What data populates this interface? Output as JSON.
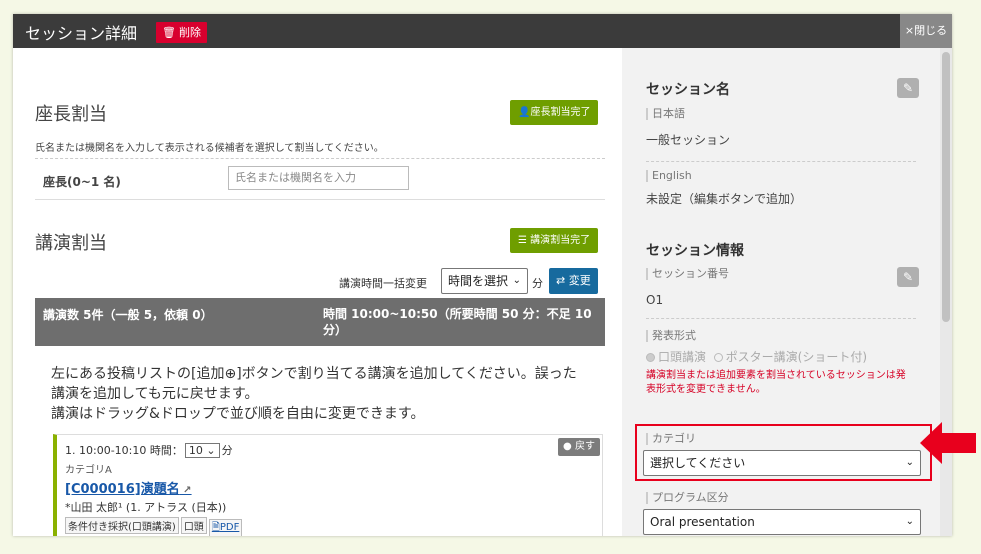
{
  "header": {
    "title": "セッション詳細",
    "delete_label": "削除",
    "close_label": "×閉じる"
  },
  "chair": {
    "title": "座長割当",
    "complete_button": "座長割当完了",
    "note": "氏名または機関名を入力して表示される候補者を選択して割当してください。",
    "field_label": "座長(0~1 名)",
    "input_placeholder": "氏名または機関名を入力"
  },
  "talks": {
    "title": "講演割当",
    "complete_button": "講演割当完了",
    "bulk_time_label": "講演時間一括変更",
    "time_select_value": "時間を選択",
    "minute_unit": "分",
    "change_button": "変更",
    "summary_left": "講演数 5件（一般 5，依頼 0）",
    "summary_right": "時間 10:00~10:50（所要時間 50 分：不足 10 分）",
    "instructions": [
      "左にある投稿リストの[追加⊕]ボタンで割り当てる講演を追加してください。誤った",
      "講演を追加しても元に戻せます。",
      "講演はドラッグ&ドロップで並び順を自由に変更できます。"
    ],
    "item": {
      "time_prefix": "1. 10:00-10:10  時間：",
      "duration": "10",
      "duration_unit": "分",
      "back_label": "戻す",
      "category": "カテゴリA",
      "title": "[C000016]演題名",
      "author": "*山田 太郎¹ (1. アトラス (日本))",
      "tags": [
        "条件付き採択(口頭講演)",
        "口頭",
        "PDF"
      ]
    }
  },
  "right": {
    "session_name_title": "セッション名",
    "japanese_label": "日本語",
    "japanese_value": "一般セッション",
    "english_label": "English",
    "english_value": "未設定（編集ボタンで追加）",
    "session_info_title": "セッション情報",
    "session_number_label": "セッション番号",
    "session_number_value": "O1",
    "format_label": "発表形式",
    "format_oral": "口頭講演",
    "format_poster": "ポスター講演(ショート付)",
    "warning": "講演割当または追加要素を割当されているセッションは発表形式を変更できません。",
    "category_label": "カテゴリ",
    "category_value": "選択してください",
    "program_label": "プログラム区分",
    "program_value": "Oral presentation"
  },
  "colors": {
    "header_bg": "#3b3b3b",
    "delete_red": "#d8002e",
    "green": "#6f9e00",
    "blue": "#176a9e",
    "highlight_red": "#e8001d"
  }
}
